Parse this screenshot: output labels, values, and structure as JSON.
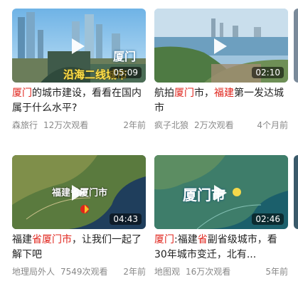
{
  "videos": [
    {
      "title_parts": [
        {
          "text": "厦门",
          "hl": true
        },
        {
          "text": "的城市建设，看看在国内属于什么水平?",
          "hl": false
        }
      ],
      "author": "森旅行",
      "views": "12万次观看",
      "time": "2年前",
      "duration": "05:09",
      "overlay": [
        "厦门",
        "沿海二线城市"
      ]
    },
    {
      "title_parts": [
        {
          "text": "航拍",
          "hl": false
        },
        {
          "text": "厦门",
          "hl": true
        },
        {
          "text": "市",
          "hl": false
        },
        {
          "text": "，",
          "hl": false
        },
        {
          "text": "福建",
          "hl": true
        },
        {
          "text": "第一发达城市",
          "hl": false
        }
      ],
      "author": "疯子北狼",
      "views": "2万次观看",
      "time": "4个月前",
      "duration": "02:10",
      "overlay": []
    },
    {
      "title_parts": [
        {
          "text": "福建",
          "hl": false
        },
        {
          "text": "省",
          "hl": true
        },
        {
          "text": "厦门市",
          "hl": true
        },
        {
          "text": "，让我们一起了解下吧",
          "hl": false
        }
      ],
      "author": "地理局外人",
      "views": "7549次观看",
      "time": "2年前",
      "duration": "04:43",
      "overlay": [
        "福建省厦门市"
      ]
    },
    {
      "title_parts": [
        {
          "text": "厦门",
          "hl": true
        },
        {
          "text": ":福建",
          "hl": false
        },
        {
          "text": "省",
          "hl": true
        },
        {
          "text": "副省级城市，看30年城市变迁，北有...",
          "hl": false
        }
      ],
      "author": "地图观",
      "views": "16万次观看",
      "time": "5年前",
      "duration": "02:46",
      "overlay": [
        "厦门市"
      ]
    }
  ]
}
